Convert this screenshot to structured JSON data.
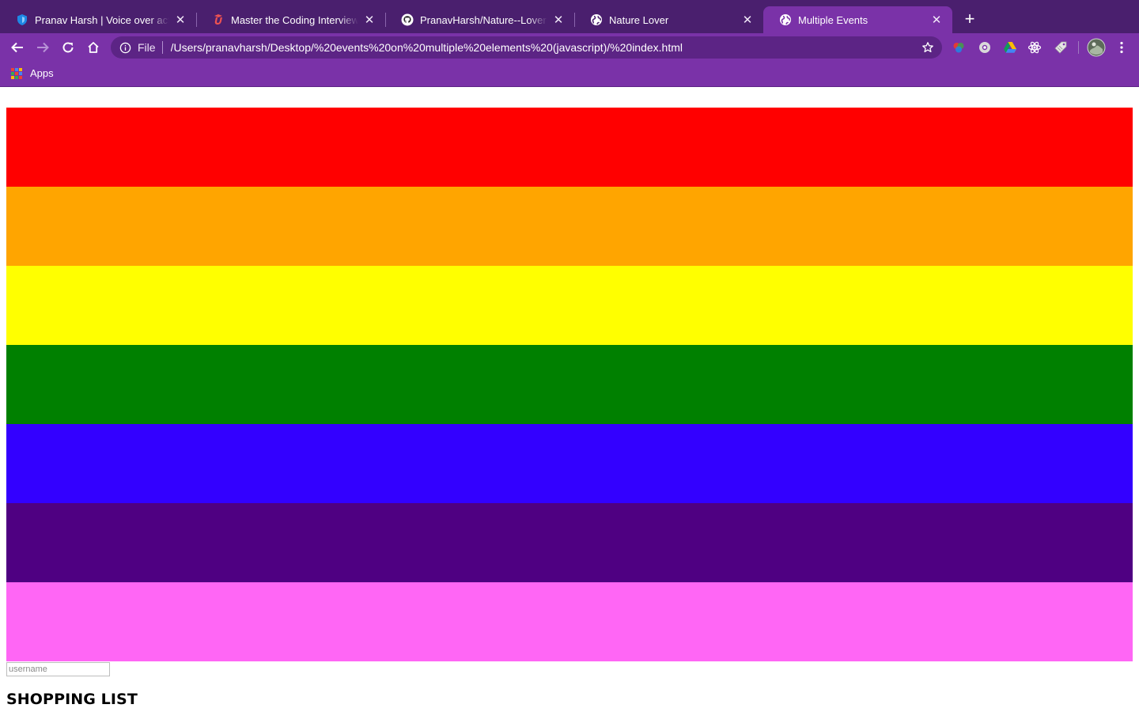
{
  "browser": {
    "tabs": [
      {
        "title": "Pranav Harsh | Voice over actor",
        "favicon": "shield-icon",
        "active": false
      },
      {
        "title": "Master the Coding Interview: Data",
        "favicon": "udemy-icon",
        "active": false
      },
      {
        "title": "PranavHarsh/Nature--Lover: for",
        "favicon": "github-icon",
        "active": false
      },
      {
        "title": "Nature Lover",
        "favicon": "globe-icon",
        "active": false
      },
      {
        "title": "Multiple Events",
        "favicon": "globe-icon",
        "active": true
      }
    ],
    "omnibox": {
      "scheme": "File",
      "url": "/Users/pranavharsh/Desktop/%20events%20on%20multiple%20elements%20(javascript)/%20index.html"
    },
    "bookmarks": [
      {
        "label": "Apps",
        "icon": "apps-grid-icon"
      }
    ],
    "theme": {
      "tabstrip": "#4a1f6e",
      "toolbar": "#7a32a8",
      "omnibox": "#5c2485"
    }
  },
  "page": {
    "stripes": [
      {
        "color": "#ff0000"
      },
      {
        "color": "#ffa500"
      },
      {
        "color": "#ffff00"
      },
      {
        "color": "#008000"
      },
      {
        "color": "#3300ff"
      },
      {
        "color": "#4f0082"
      },
      {
        "color": "#ff66f5"
      }
    ],
    "username_input": {
      "placeholder": "username",
      "value": ""
    },
    "heading": "SHOPPING LIST"
  }
}
